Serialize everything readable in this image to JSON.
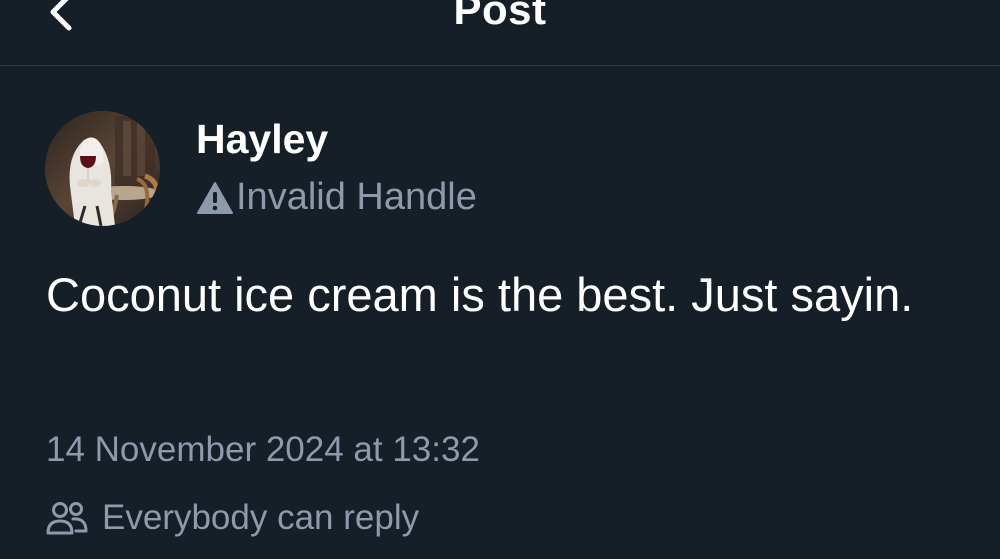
{
  "header": {
    "title": "Post",
    "back_icon": "chevron-left-icon"
  },
  "post": {
    "author": {
      "display_name": "Hayley",
      "handle": "Invalid Handle",
      "handle_icon": "warning-icon",
      "avatar": "avatar-image"
    },
    "text": "Coconut ice cream is the best. Just sayin.",
    "timestamp": "14 November 2024 at 13:32",
    "reply_setting": {
      "label": "Everybody can reply",
      "icon": "people-icon"
    }
  },
  "colors": {
    "background": "#161e27",
    "text_primary": "#ffffff",
    "text_secondary": "#8c9aab",
    "divider": "#2e3844"
  }
}
